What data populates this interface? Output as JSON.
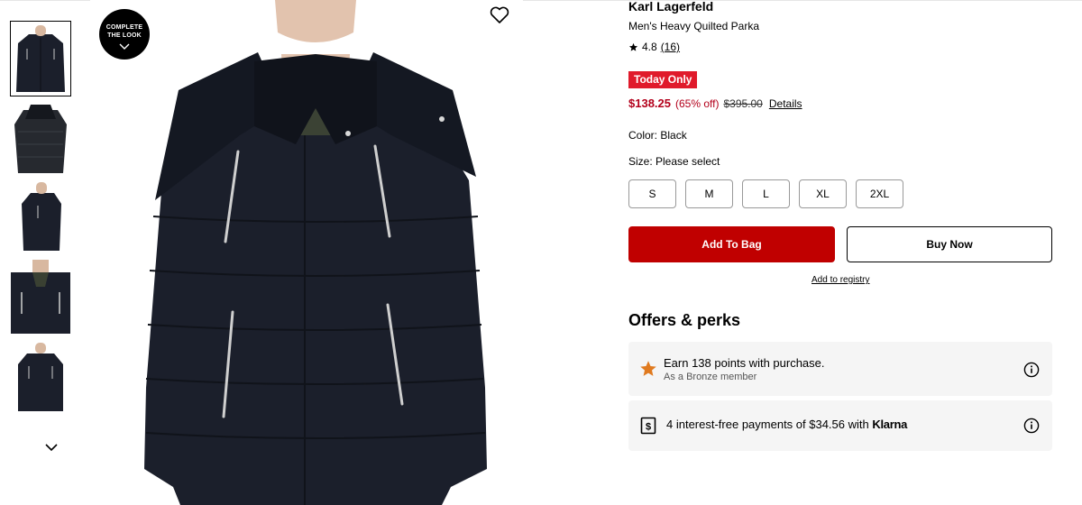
{
  "product": {
    "brand": "Karl Lagerfeld",
    "name": "Men's Heavy Quilted Parka",
    "rating": "4.8",
    "review_count": "(16)",
    "badge": "Today Only",
    "sale_price": "$138.25",
    "percent_off": "(65% off)",
    "original_price": "$395.00",
    "details_link": "Details",
    "color_label": "Color: Black",
    "size_label": "Size: Please select",
    "sizes": [
      "S",
      "M",
      "L",
      "XL",
      "2XL"
    ]
  },
  "actions": {
    "add_to_bag": "Add To Bag",
    "buy_now": "Buy Now",
    "add_to_registry": "Add to registry"
  },
  "gallery": {
    "complete_look_line1": "COMPLETE",
    "complete_look_line2": "THE LOOK",
    "thumbnail_count": 5,
    "selected_index": 0
  },
  "offers": {
    "heading": "Offers & perks",
    "points_line": "Earn 138 points with purchase.",
    "member_line": "As a Bronze member",
    "payments_line": "4 interest-free payments of $34.56 with ",
    "payments_brand": "Klarna"
  },
  "colors": {
    "sale_red": "#b3001b",
    "badge_red": "#e01a2b",
    "add_to_bag_red": "#c00000",
    "perk_bg": "#f5f5f5",
    "star_orange": "#e07a1f",
    "jacket": "#1b1f2b"
  },
  "icons": {
    "favorite": "heart-icon",
    "rating": "star-icon",
    "points": "star-orange-icon",
    "payments": "dollar-card-icon",
    "info": "info-icon",
    "gallery_scroll": "chevron-down-icon"
  }
}
